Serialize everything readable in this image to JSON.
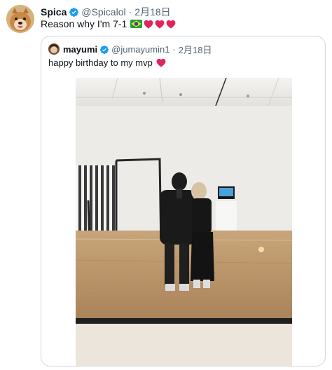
{
  "tweet": {
    "author_name": "Spica",
    "author_handle": "@Spicalol",
    "separator": "·",
    "date": "2月18日",
    "text": "Reason why I'm 7-1",
    "emojis": [
      "brazil-flag",
      "red-heart",
      "red-heart",
      "red-heart"
    ]
  },
  "quoted": {
    "author_name": "mayumi",
    "author_handle": "@jumayumin1",
    "separator": "·",
    "date": "2月18日",
    "text": "happy birthday to my mvp",
    "emojis": [
      "red-heart"
    ],
    "media": "photo-mirror-selfie-museum"
  },
  "colors": {
    "verified": "#1d9bf0",
    "muted": "#536471",
    "border": "#cfd9de",
    "heart": "#e0245e"
  }
}
